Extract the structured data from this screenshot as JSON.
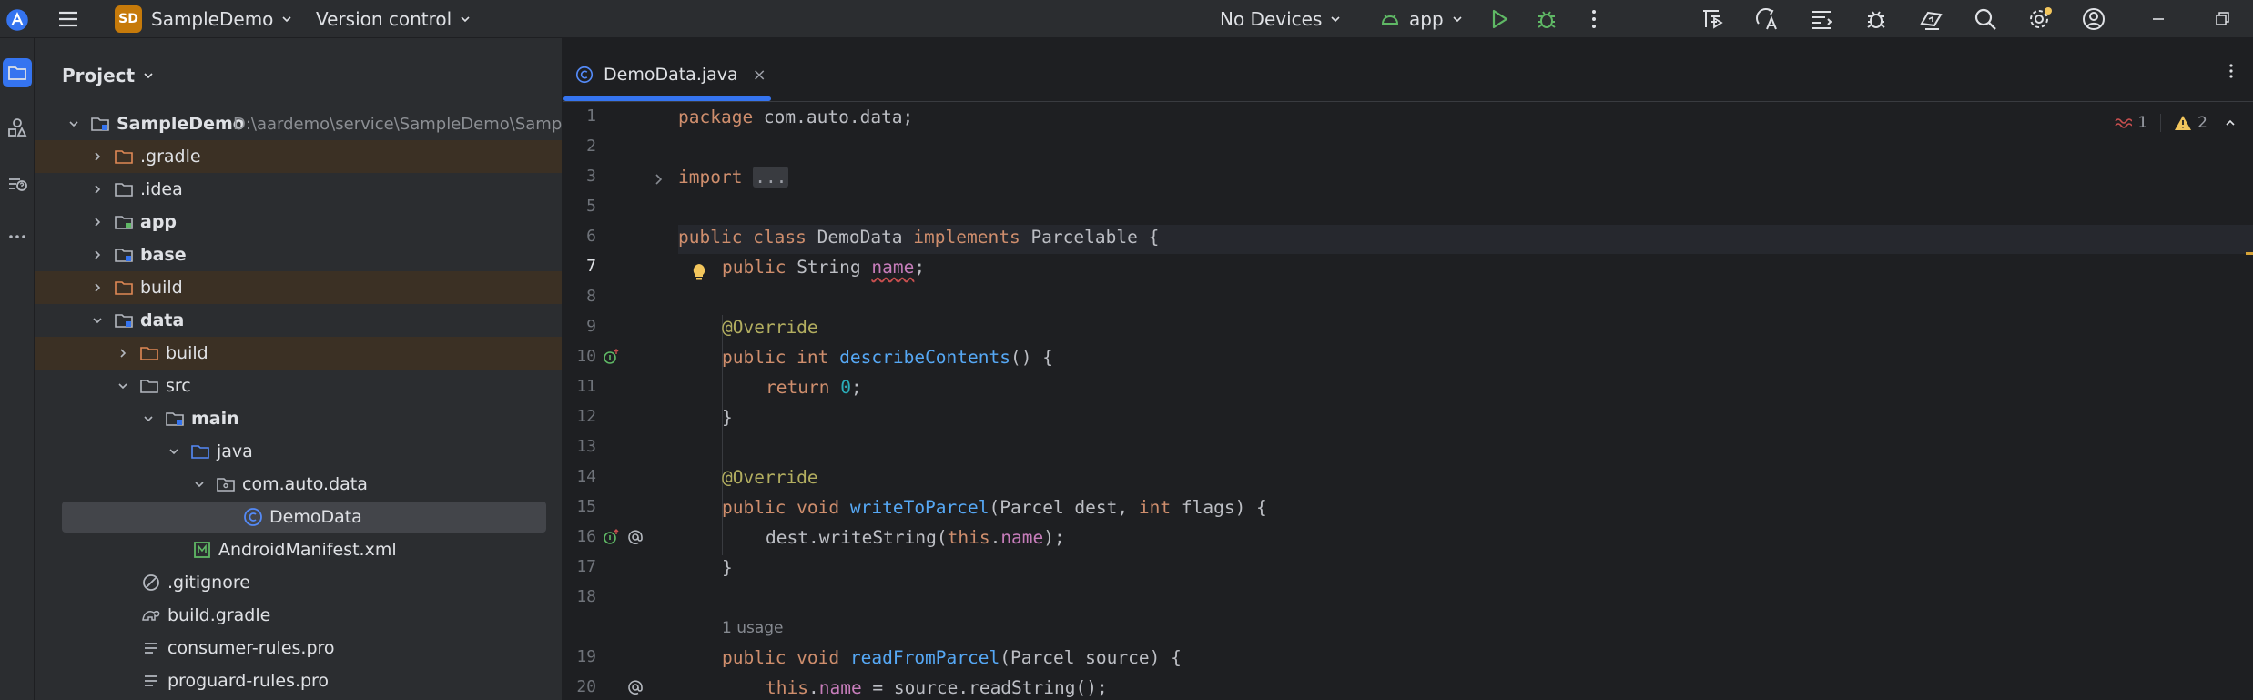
{
  "toolbar": {
    "project_badge": "SD",
    "project_name": "SampleDemo",
    "vcs_label": "Version control",
    "device_label": "No Devices",
    "run_config": "app",
    "icons": [
      "app-logo-icon",
      "main-menu-icon",
      "run-icon",
      "debug-icon",
      "more-actions-icon",
      "profiler-icon",
      "translate-icon",
      "code-review-icon",
      "layout-inspector-icon",
      "device-mirror-icon",
      "search-icon",
      "settings-icon",
      "account-icon",
      "minimize-icon",
      "restore-icon"
    ]
  },
  "colors": {
    "background": "#1e1f22",
    "panel": "#2b2d30",
    "accent": "#3574f0",
    "excluded_row": "#3b3024",
    "selected_row": "#43454a",
    "keyword": "#cf8e6d",
    "annotation": "#b3ae60",
    "method": "#56a8f5",
    "field": "#c77dbb",
    "number": "#2aacb8",
    "error": "#c94f4f",
    "warning": "#f2c55c"
  },
  "project_panel": {
    "title": "Project",
    "root": {
      "label": "SampleDemo",
      "path": "D:\\aardemo\\service\\SampleDemo\\SampleDemo"
    },
    "items": [
      {
        "label": ".gradle",
        "excluded": true
      },
      {
        "label": ".idea"
      },
      {
        "label": "app",
        "bold": true
      },
      {
        "label": "base",
        "bold": true
      },
      {
        "label": "build",
        "excluded": true
      },
      {
        "label": "data",
        "bold": true
      },
      {
        "label": "build",
        "excluded": true
      },
      {
        "label": "src"
      },
      {
        "label": "main",
        "bold": true
      },
      {
        "label": "java"
      },
      {
        "label": "com.auto.data"
      },
      {
        "label": "DemoData",
        "selected": true
      },
      {
        "label": "AndroidManifest.xml"
      },
      {
        "label": ".gitignore"
      },
      {
        "label": "build.gradle"
      },
      {
        "label": "consumer-rules.pro"
      },
      {
        "label": "proguard-rules.pro"
      }
    ]
  },
  "editor": {
    "tab_label": "DemoData.java",
    "tab_close": "×",
    "inspections": {
      "errors": "1",
      "warnings": "2"
    },
    "code": {
      "l1_kw": "package",
      "l1_rest": " com.auto.data;",
      "l3_kw": "import",
      "l3_fold": "...",
      "l6_kw1": "public class",
      "l6_name": " DemoData ",
      "l6_kw2": "implements",
      "l6_rest": " Parcelable {",
      "l7_kw": "public",
      "l7_type": " String ",
      "l7_field": "name",
      "l7_end": ";",
      "l9_ann": "@Override",
      "l10_kw": "public int",
      "l10_fn": " describeContents",
      "l10_rest": "() {",
      "l11_kw": "return",
      "l11_num": " 0",
      "l11_end": ";",
      "l12": "}",
      "l14_ann": "@Override",
      "l15_kw": "public void",
      "l15_fn": " writeToParcel",
      "l15_rest1": "(Parcel dest, ",
      "l15_kw2": "int",
      "l15_rest2": " flags) {",
      "l16_a": "dest.writeString(",
      "l16_kw": "this",
      "l16_dot": ".",
      "l16_field": "name",
      "l16_end": ");",
      "l17": "}",
      "l19_hint": "1 usage",
      "l19_kw": "public void",
      "l19_fn": " readFromParcel",
      "l19_rest": "(Parcel source) {",
      "l20_kw": "this",
      "l20_dot": ".",
      "l20_field": "name",
      "l20_rest": " = source.readString();"
    },
    "line_numbers": [
      "1",
      "2",
      "3",
      "5",
      "6",
      "7",
      "8",
      "9",
      "10",
      "11",
      "12",
      "13",
      "14",
      "15",
      "16",
      "17",
      "18",
      "19",
      "20"
    ]
  }
}
